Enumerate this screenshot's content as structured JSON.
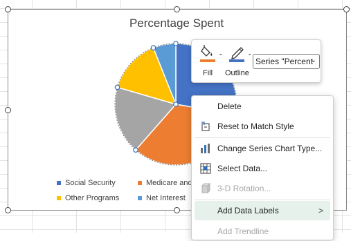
{
  "chart": {
    "title": "Percentage Spent",
    "legend": [
      {
        "label": "Social Security",
        "color": "#4472c4"
      },
      {
        "label": "Medicare and",
        "color": "#ed7d31"
      },
      {
        "label": "Other Programs",
        "color": "#ffc000"
      },
      {
        "label": "Net Interest",
        "color": "#5b9bd5"
      }
    ]
  },
  "chart_data": {
    "type": "pie",
    "title": "Percentage Spent",
    "series": [
      {
        "values": [
          23,
          28,
          15,
          12,
          5
        ],
        "colors": [
          "#4472c4",
          "#ed7d31",
          "#a5a5a5",
          "#ffc000",
          "#5b9bd5"
        ]
      }
    ],
    "categories": [
      "Social Security",
      "Medicare and",
      "",
      "Other Programs",
      "Net Interest"
    ],
    "legend_position": "bottom",
    "selected_series": true
  },
  "mini_toolbar": {
    "fill_label": "Fill",
    "outline_label": "Outline",
    "series_select": "Series \"Percent",
    "fill_color": "#ed7d31",
    "outline_color": "#4472c4"
  },
  "context_menu": {
    "items": [
      {
        "label": "Delete",
        "icon": "none",
        "disabled": false
      },
      {
        "label": "Reset to Match Style",
        "icon": "reset-style-icon",
        "disabled": false
      },
      {
        "label": "Change Series Chart Type...",
        "icon": "chart-type-icon",
        "disabled": false
      },
      {
        "label": "Select Data...",
        "icon": "select-data-icon",
        "disabled": false
      },
      {
        "label": "3-D Rotation...",
        "icon": "rotation-3d-icon",
        "disabled": true
      },
      {
        "label": "Add Data Labels",
        "icon": "none",
        "disabled": false,
        "submenu": true
      },
      {
        "label": "Add Trendline",
        "icon": "none",
        "disabled": true
      }
    ]
  }
}
